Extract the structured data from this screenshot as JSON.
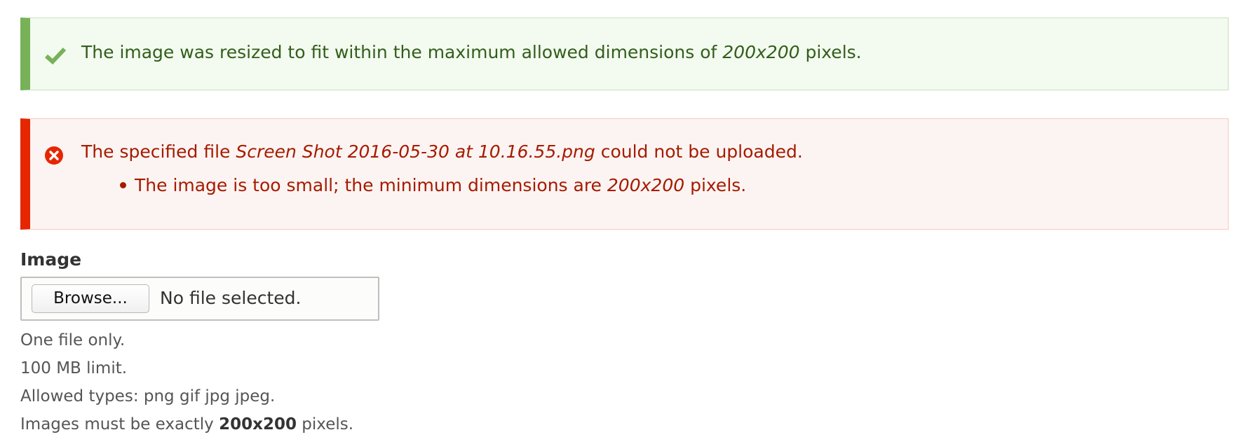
{
  "messages": {
    "status": {
      "icon": "check-icon",
      "color": "#77b259",
      "text_before": "The image was resized to fit within the maximum allowed dimensions of",
      "dimensions": "200x200",
      "text_after": "pixels."
    },
    "error": {
      "icon": "error-circle-icon",
      "color": "#e62600",
      "text_before": "The specified file",
      "filename": "Screen Shot 2016-05-30 at 10.16.55.png",
      "text_after": "could not be uploaded.",
      "items": [
        {
          "text_before": "The image is too small; the minimum dimensions are",
          "dimensions": "200x200",
          "text_after": "pixels."
        }
      ]
    }
  },
  "form": {
    "image_field": {
      "label": "Image",
      "browse_label": "Browse...",
      "file_status": "No file selected.",
      "description": {
        "count": "One file only.",
        "size_limit": "100 MB limit.",
        "types": "Allowed types: png gif jpg jpeg.",
        "exact_before": "Images must be exactly",
        "exact_dimensions": "200x200",
        "exact_after": "pixels."
      }
    }
  }
}
